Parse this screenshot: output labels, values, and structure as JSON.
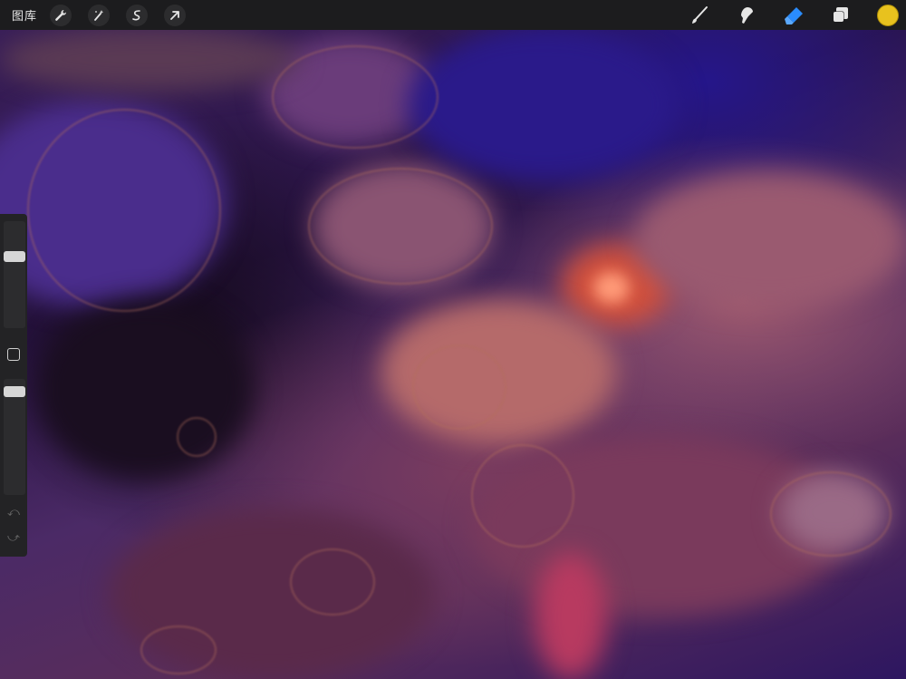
{
  "topbar": {
    "gallery_label": "图库",
    "left_tools": [
      "wrench-icon",
      "magic-wand-icon",
      "selection-icon",
      "move-icon"
    ],
    "right_tools": [
      "brush-icon",
      "smudge-icon",
      "eraser-icon",
      "layers-icon"
    ],
    "active_tool": "eraser-icon",
    "current_color": "#e8c21e"
  },
  "sidebar": {
    "brush_size_level": 0.31,
    "opacity_level": 0.07,
    "undo_icon": "undo-icon",
    "redo_icon": "redo-icon"
  },
  "colors": {
    "toolbar_bg": "#1c1c1e",
    "accent_blue": "#2a8cff"
  }
}
